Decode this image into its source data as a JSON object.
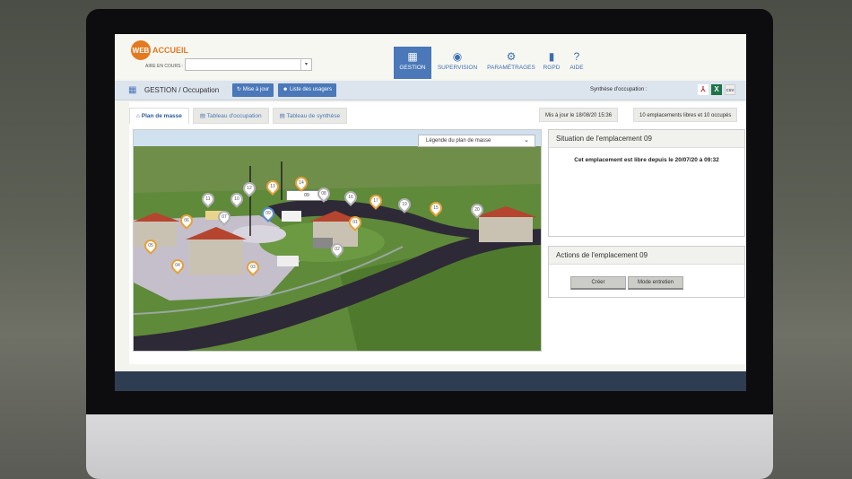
{
  "app": {
    "logo_web": "WEB",
    "logo_accueil": "ACCUEIL",
    "aire_label": "AIRE EN COURS :",
    "aire_value": ""
  },
  "nav": [
    {
      "label": "GESTION",
      "icon": "grid-icon"
    },
    {
      "label": "SUPERVISION",
      "icon": "eye-icon"
    },
    {
      "label": "PARAMÉTRAGES",
      "icon": "gear-icon"
    },
    {
      "label": "RGPD",
      "icon": "document-icon"
    },
    {
      "label": "AIDE",
      "icon": "help-icon"
    }
  ],
  "subbar": {
    "breadcrumb": "GESTION / Occupation",
    "refresh_button": "Mise à jour",
    "users_button": "Liste des usagers",
    "synthese_label": "Synthèse d'occupation :"
  },
  "tabs": [
    {
      "label": "Plan de masse"
    },
    {
      "label": "Tableau d'occupation"
    },
    {
      "label": "Tableau de synthèse"
    }
  ],
  "status": {
    "updated": "Mis à jour le 18/08/20 15:36",
    "counts": "10 emplacements libres et 10 occupés"
  },
  "map": {
    "legend_select": "Légende du plan de masse",
    "bubble": "09",
    "pins": [
      "11",
      "10",
      "12",
      "13",
      "14",
      "07",
      "09",
      "08",
      "16",
      "17",
      "15",
      "19",
      "20",
      "06",
      "05",
      "04",
      "03",
      "02",
      "01"
    ]
  },
  "situation": {
    "title": "Situation de l'emplacement 09",
    "message": "Cet emplacement est libre depuis le 20/07/20 à 09:32"
  },
  "actions": {
    "title": "Actions de l'emplacement 09",
    "create_button": "Créer",
    "maintenance_button": "Mode entretien"
  },
  "colors": {
    "accent": "#4a78b8",
    "brand": "#e37a22",
    "footer": "#2f3d52"
  }
}
